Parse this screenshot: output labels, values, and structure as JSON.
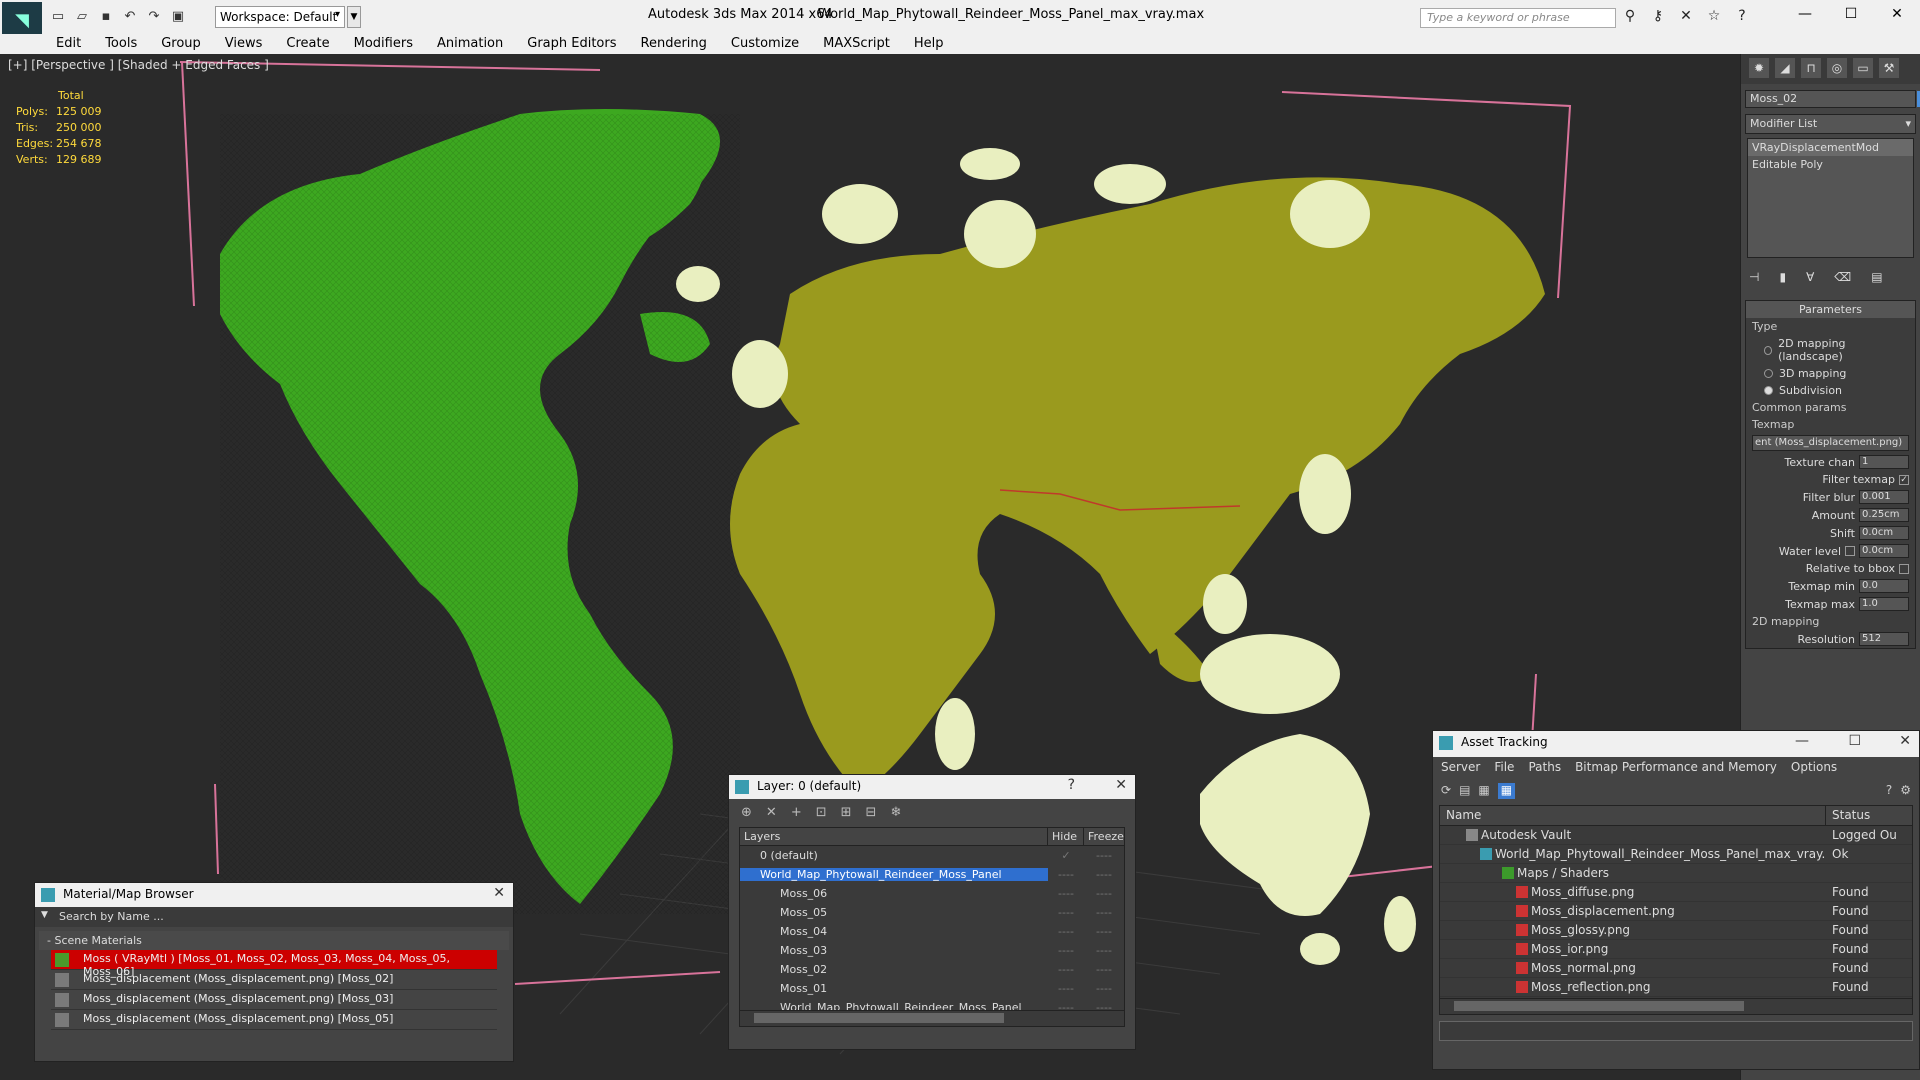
{
  "window": {
    "app_title": "Autodesk 3ds Max  2014 x64",
    "file_title": "World_Map_Phytowall_Reindeer_Moss_Panel_max_vray.max",
    "workspace": "Workspace: Default",
    "search_placeholder": "Type a keyword or phrase",
    "minimize": "—",
    "maximize": "☐",
    "close": "✕"
  },
  "menubar": [
    "Edit",
    "Tools",
    "Group",
    "Views",
    "Create",
    "Modifiers",
    "Animation",
    "Graph Editors",
    "Rendering",
    "Customize",
    "MAXScript",
    "Help"
  ],
  "viewport": {
    "label": "[+] [Perspective ] [Shaded + Edged Faces ]",
    "stats": {
      "header": "Total",
      "polys_label": "Polys:",
      "polys": "125 009",
      "tris_label": "Tris:",
      "tris": "250 000",
      "edges_label": "Edges:",
      "edges": "254 678",
      "verts_label": "Verts:",
      "verts": "129 689"
    },
    "colors": {
      "americas": "#3da820",
      "eurasia": "#9a9a1e",
      "islands": "#e9efc0"
    }
  },
  "command_panel": {
    "object_name": "Moss_02",
    "object_color": "#4a8fdc",
    "modifier_list": "Modifier List",
    "stack": [
      "VRayDisplacementMod",
      "Editable Poly"
    ],
    "parameters_title": "Parameters",
    "type_label": "Type",
    "type_options": [
      "2D mapping (landscape)",
      "3D mapping",
      "Subdivision"
    ],
    "common_params": "Common params",
    "texmap_label": "Texmap",
    "texmap_value": "ent (Moss_displacement.png)",
    "texture_chan_label": "Texture chan",
    "texture_chan": "1",
    "filter_texmap_label": "Filter texmap",
    "filter_blur_label": "Filter blur",
    "filter_blur": "0.001",
    "amount_label": "Amount",
    "amount": "0.25cm",
    "shift_label": "Shift",
    "shift": "0.0cm",
    "water_level_label": "Water level",
    "water_level": "0.0cm",
    "relative_bbox_label": "Relative to bbox",
    "texmap_min_label": "Texmap min",
    "texmap_min": "0.0",
    "texmap_max_label": "Texmap max",
    "texmap_max": "1.0",
    "mapping_2d": "2D mapping",
    "resolution_label": "Resolution",
    "resolution": "512"
  },
  "material_browser": {
    "title": "Material/Map Browser",
    "search_placeholder": "Search by Name ...",
    "section": "- Scene Materials",
    "rows": [
      "Moss  ( VRayMtl ) [Moss_01, Moss_02, Moss_03, Moss_04, Moss_05, Moss_06]",
      "Moss_displacement (Moss_displacement.png) [Moss_02]",
      "Moss_displacement (Moss_displacement.png) [Moss_03]",
      "Moss_displacement (Moss_displacement.png) [Moss_05]"
    ]
  },
  "layer_dialog": {
    "title": "Layer: 0 (default)",
    "help": "?",
    "close": "✕",
    "col_layers": "Layers",
    "col_hide": "Hide",
    "col_freeze": "Freeze",
    "rows": [
      {
        "name": "0 (default)",
        "hide": "✓",
        "freeze": "----"
      },
      {
        "name": "World_Map_Phytowall_Reindeer_Moss_Panel",
        "hide": "----",
        "freeze": "----"
      },
      {
        "name": "Moss_06",
        "hide": "----",
        "freeze": "----"
      },
      {
        "name": "Moss_05",
        "hide": "----",
        "freeze": "----"
      },
      {
        "name": "Moss_04",
        "hide": "----",
        "freeze": "----"
      },
      {
        "name": "Moss_03",
        "hide": "----",
        "freeze": "----"
      },
      {
        "name": "Moss_02",
        "hide": "----",
        "freeze": "----"
      },
      {
        "name": "Moss_01",
        "hide": "----",
        "freeze": "----"
      },
      {
        "name": "World_Map_Phytowall_Reindeer_Moss_Panel",
        "hide": "----",
        "freeze": "----"
      }
    ]
  },
  "asset_tracking": {
    "title": "Asset Tracking",
    "menu": [
      "Server",
      "File",
      "Paths",
      "Bitmap Performance and Memory",
      "Options"
    ],
    "col_name": "Name",
    "col_status": "Status",
    "rows": [
      {
        "name": "Autodesk Vault",
        "status": "Logged Ou"
      },
      {
        "name": "World_Map_Phytowall_Reindeer_Moss_Panel_max_vray.max",
        "status": "Ok"
      },
      {
        "name": "Maps / Shaders",
        "status": ""
      },
      {
        "name": "Moss_diffuse.png",
        "status": "Found"
      },
      {
        "name": "Moss_displacement.png",
        "status": "Found"
      },
      {
        "name": "Moss_glossy.png",
        "status": "Found"
      },
      {
        "name": "Moss_ior.png",
        "status": "Found"
      },
      {
        "name": "Moss_normal.png",
        "status": "Found"
      },
      {
        "name": "Moss_reflection.png",
        "status": "Found"
      }
    ]
  }
}
